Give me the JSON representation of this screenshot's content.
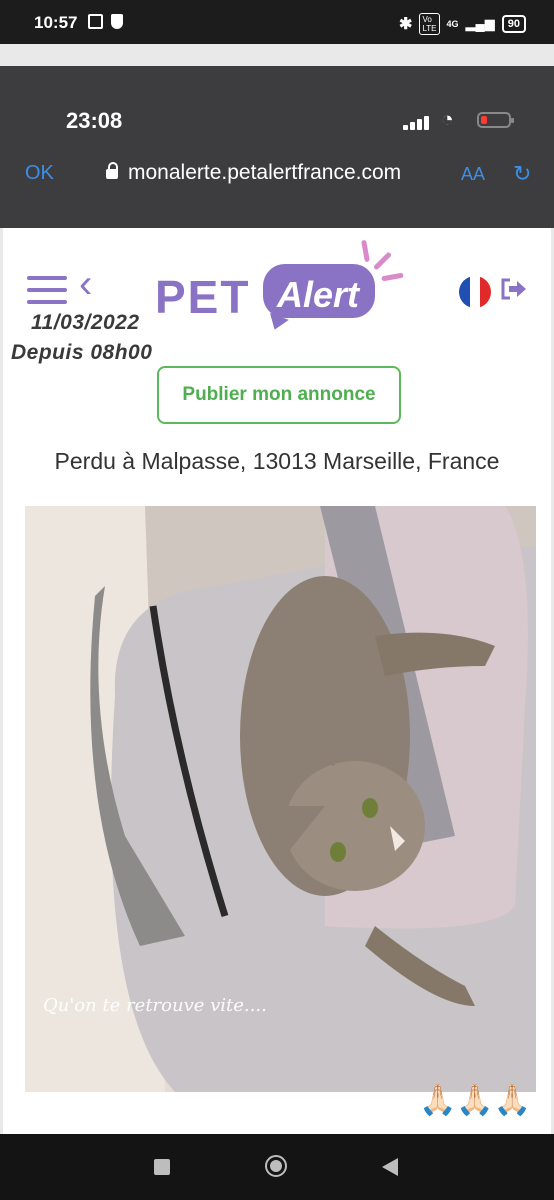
{
  "android_status": {
    "time": "10:57",
    "network": "4G",
    "battery": "90"
  },
  "ios_status": {
    "time": "23:08"
  },
  "browser": {
    "ok_label": "OK",
    "url": "monalerte.petalertfrance.com",
    "text_size_label": "AA"
  },
  "site": {
    "logo_pet": "PET",
    "logo_alert": "Alert",
    "language_flag": "france-flag",
    "colors": {
      "brand_purple": "#8a72c4",
      "accent_pink": "#d98acb",
      "button_green": "#5cb85c"
    }
  },
  "overlay": {
    "date": "11/03/2022",
    "since": "Depuis 08h00"
  },
  "publish_button": "Publier mon annonce",
  "location": "Perdu à Malpasse, 13013 Marseille, France",
  "photo": {
    "caption": "Qu'on te retrouve vite....",
    "emojis": "🙏🏻🙏🏻🙏🏻"
  }
}
